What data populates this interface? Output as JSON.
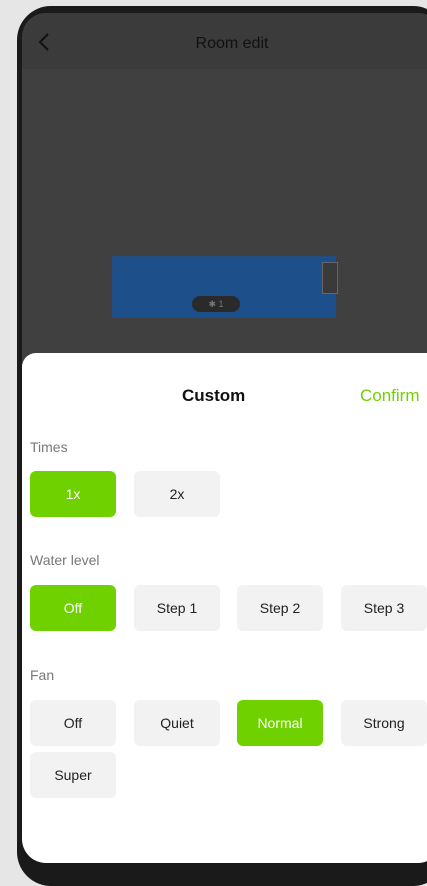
{
  "header": {
    "title": "Room edit",
    "back_icon": "chevron-left-icon"
  },
  "sheet": {
    "title": "Custom",
    "confirm_label": "Confirm",
    "sections": {
      "times": {
        "label": "Times",
        "options": [
          "1x",
          "2x"
        ],
        "selected": "1x"
      },
      "water": {
        "label": "Water level",
        "options": [
          "Off",
          "Step 1",
          "Step 2",
          "Step 3"
        ],
        "selected": "Off"
      },
      "fan": {
        "label": "Fan",
        "options": [
          "Off",
          "Quiet",
          "Normal",
          "Strong",
          "Super"
        ],
        "selected": "Normal"
      }
    }
  },
  "colors": {
    "accent": "#6fd100",
    "sheet_bg": "#ffffff",
    "option_bg": "#f2f2f2"
  }
}
